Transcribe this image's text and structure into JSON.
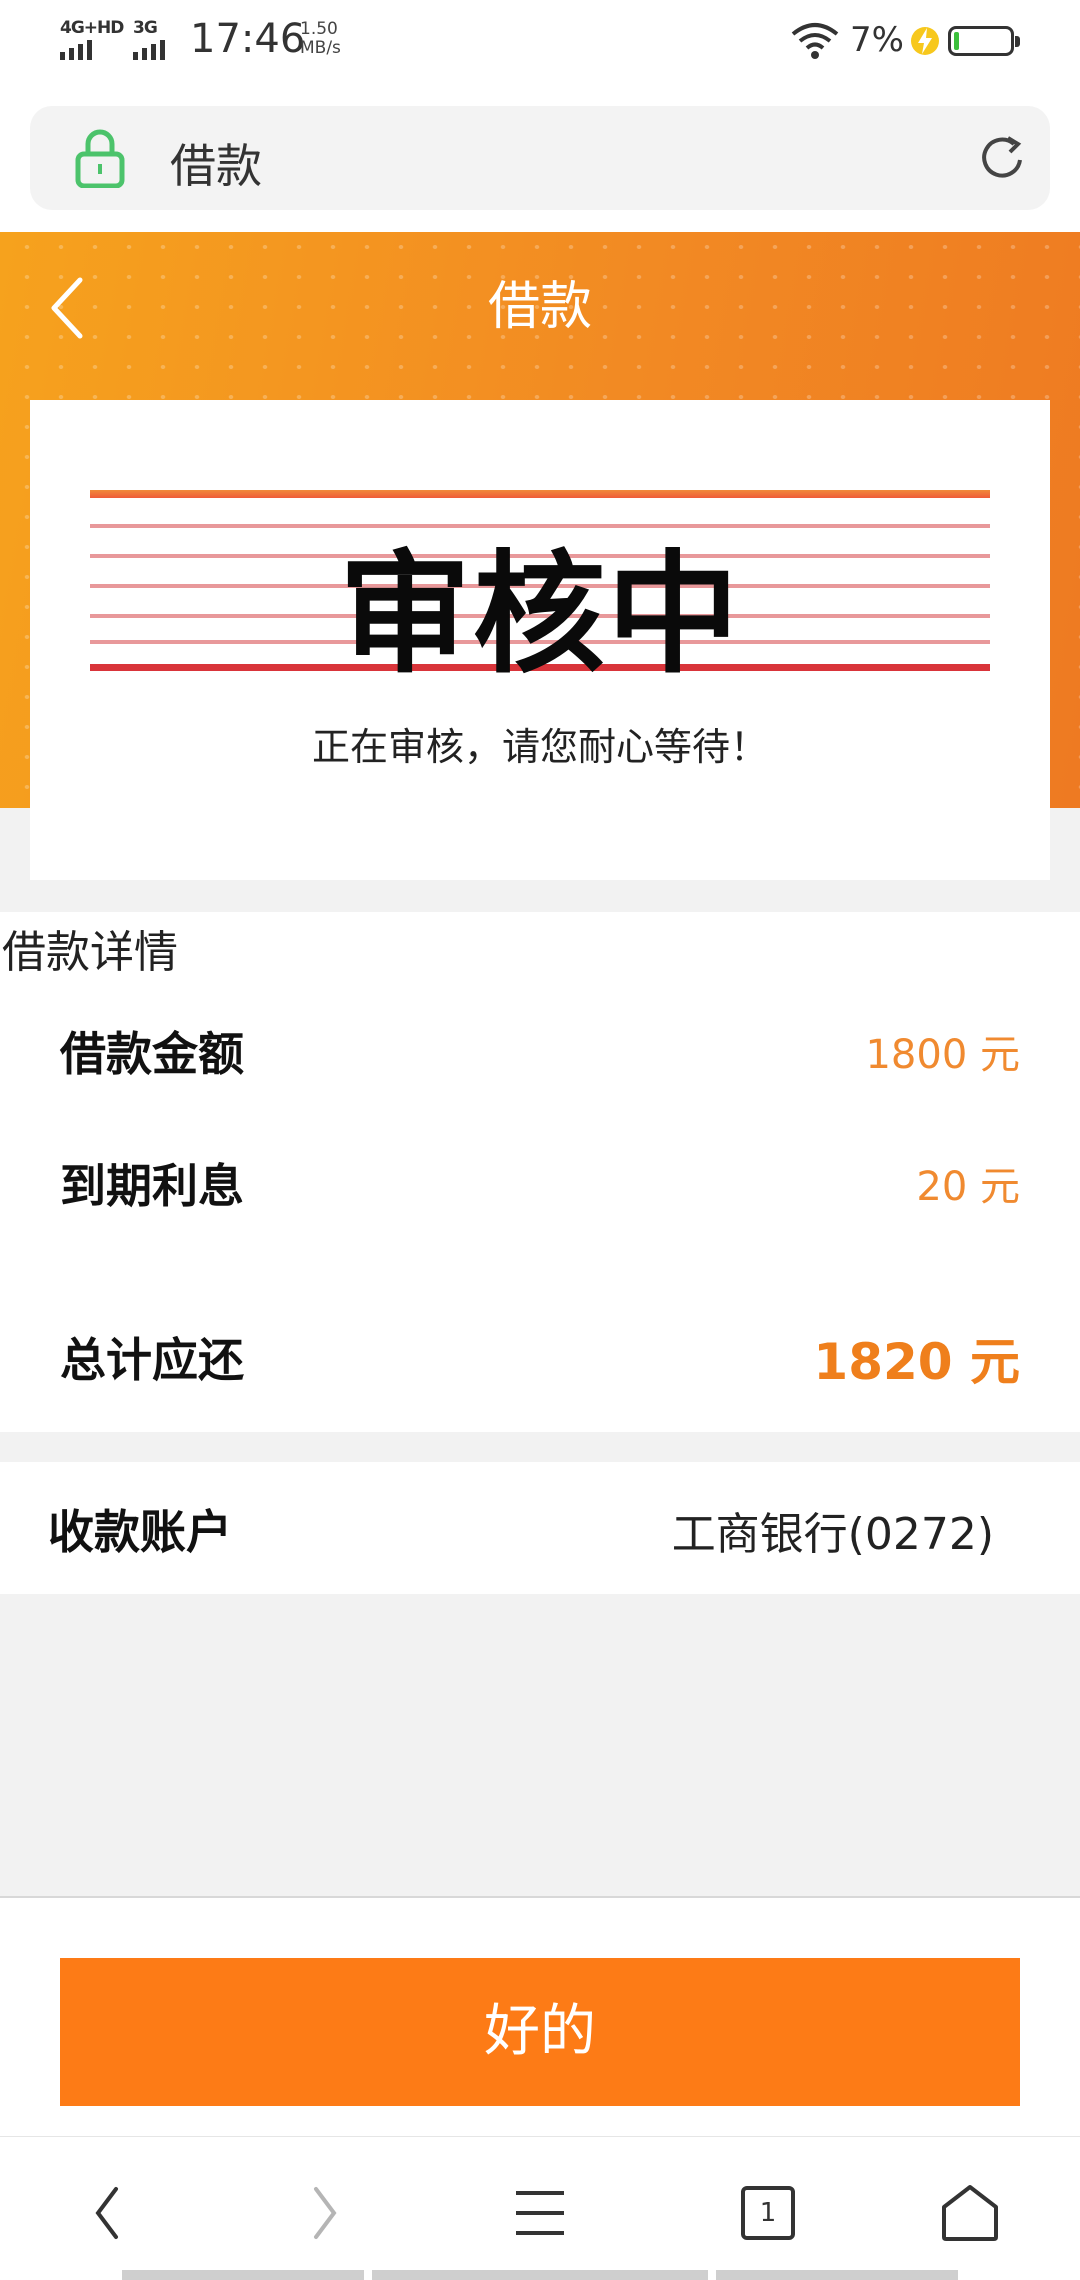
{
  "status_bar": {
    "network1": "4G+HD",
    "network2": "3G",
    "time": "17:46",
    "speed_value": "1.50",
    "speed_unit": "MB/s",
    "battery_percent": "7%",
    "battery_level": 0.07
  },
  "browser": {
    "url_title": "借款"
  },
  "header": {
    "title": "借款"
  },
  "status_card": {
    "stamp": "审核中",
    "message": "正在审核，请您耐心等待！"
  },
  "details": {
    "section_title": "借款详情",
    "rows": [
      {
        "label": "借款金额",
        "value": "1800 元"
      },
      {
        "label": "到期利息",
        "value": "20 元"
      },
      {
        "label": "总计应还",
        "value": "1820 元"
      }
    ]
  },
  "account": {
    "label": "收款账户",
    "value": "工商银行(0272)"
  },
  "actions": {
    "ok_label": "好的"
  },
  "nav": {
    "tab_count": "1"
  },
  "colors": {
    "accent": "#fd7b16",
    "header_start": "#f6a21d",
    "header_end": "#ee7a22",
    "value_orange": "#f08a30"
  }
}
